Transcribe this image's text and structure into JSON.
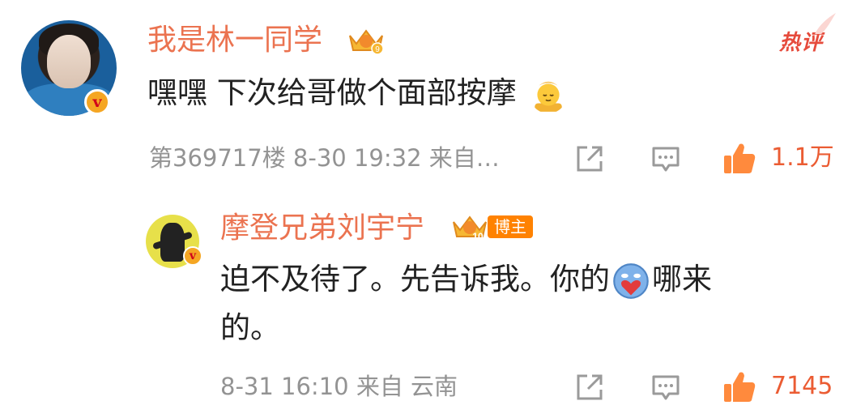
{
  "comment": {
    "author": "我是林一同学",
    "content": "嘿嘿 下次给哥做个面部按摩",
    "floor_time": "第369717楼 8-30 19:32 来自…",
    "likes": "1.1万",
    "hot_label": "热评",
    "level_badge": "9",
    "emoji_icon": "face-massage-emoji"
  },
  "reply": {
    "author": "摩登兄弟刘宇宁",
    "blogger_tag": "博主",
    "level_badge": "10",
    "content_line1_a": "迫不及待了。先告诉我。你的",
    "content_line1_b": "哪来",
    "content_line2": "的。",
    "time_location": "8-31 16:10 来自 云南",
    "likes": "7145",
    "emoji_icon": "heart-face-emoji"
  },
  "colors": {
    "name": "#eb7350",
    "meta": "#939393",
    "like": "#eb5c33",
    "hot": "#e64b3c",
    "blogger_tag": "#ff8200"
  }
}
